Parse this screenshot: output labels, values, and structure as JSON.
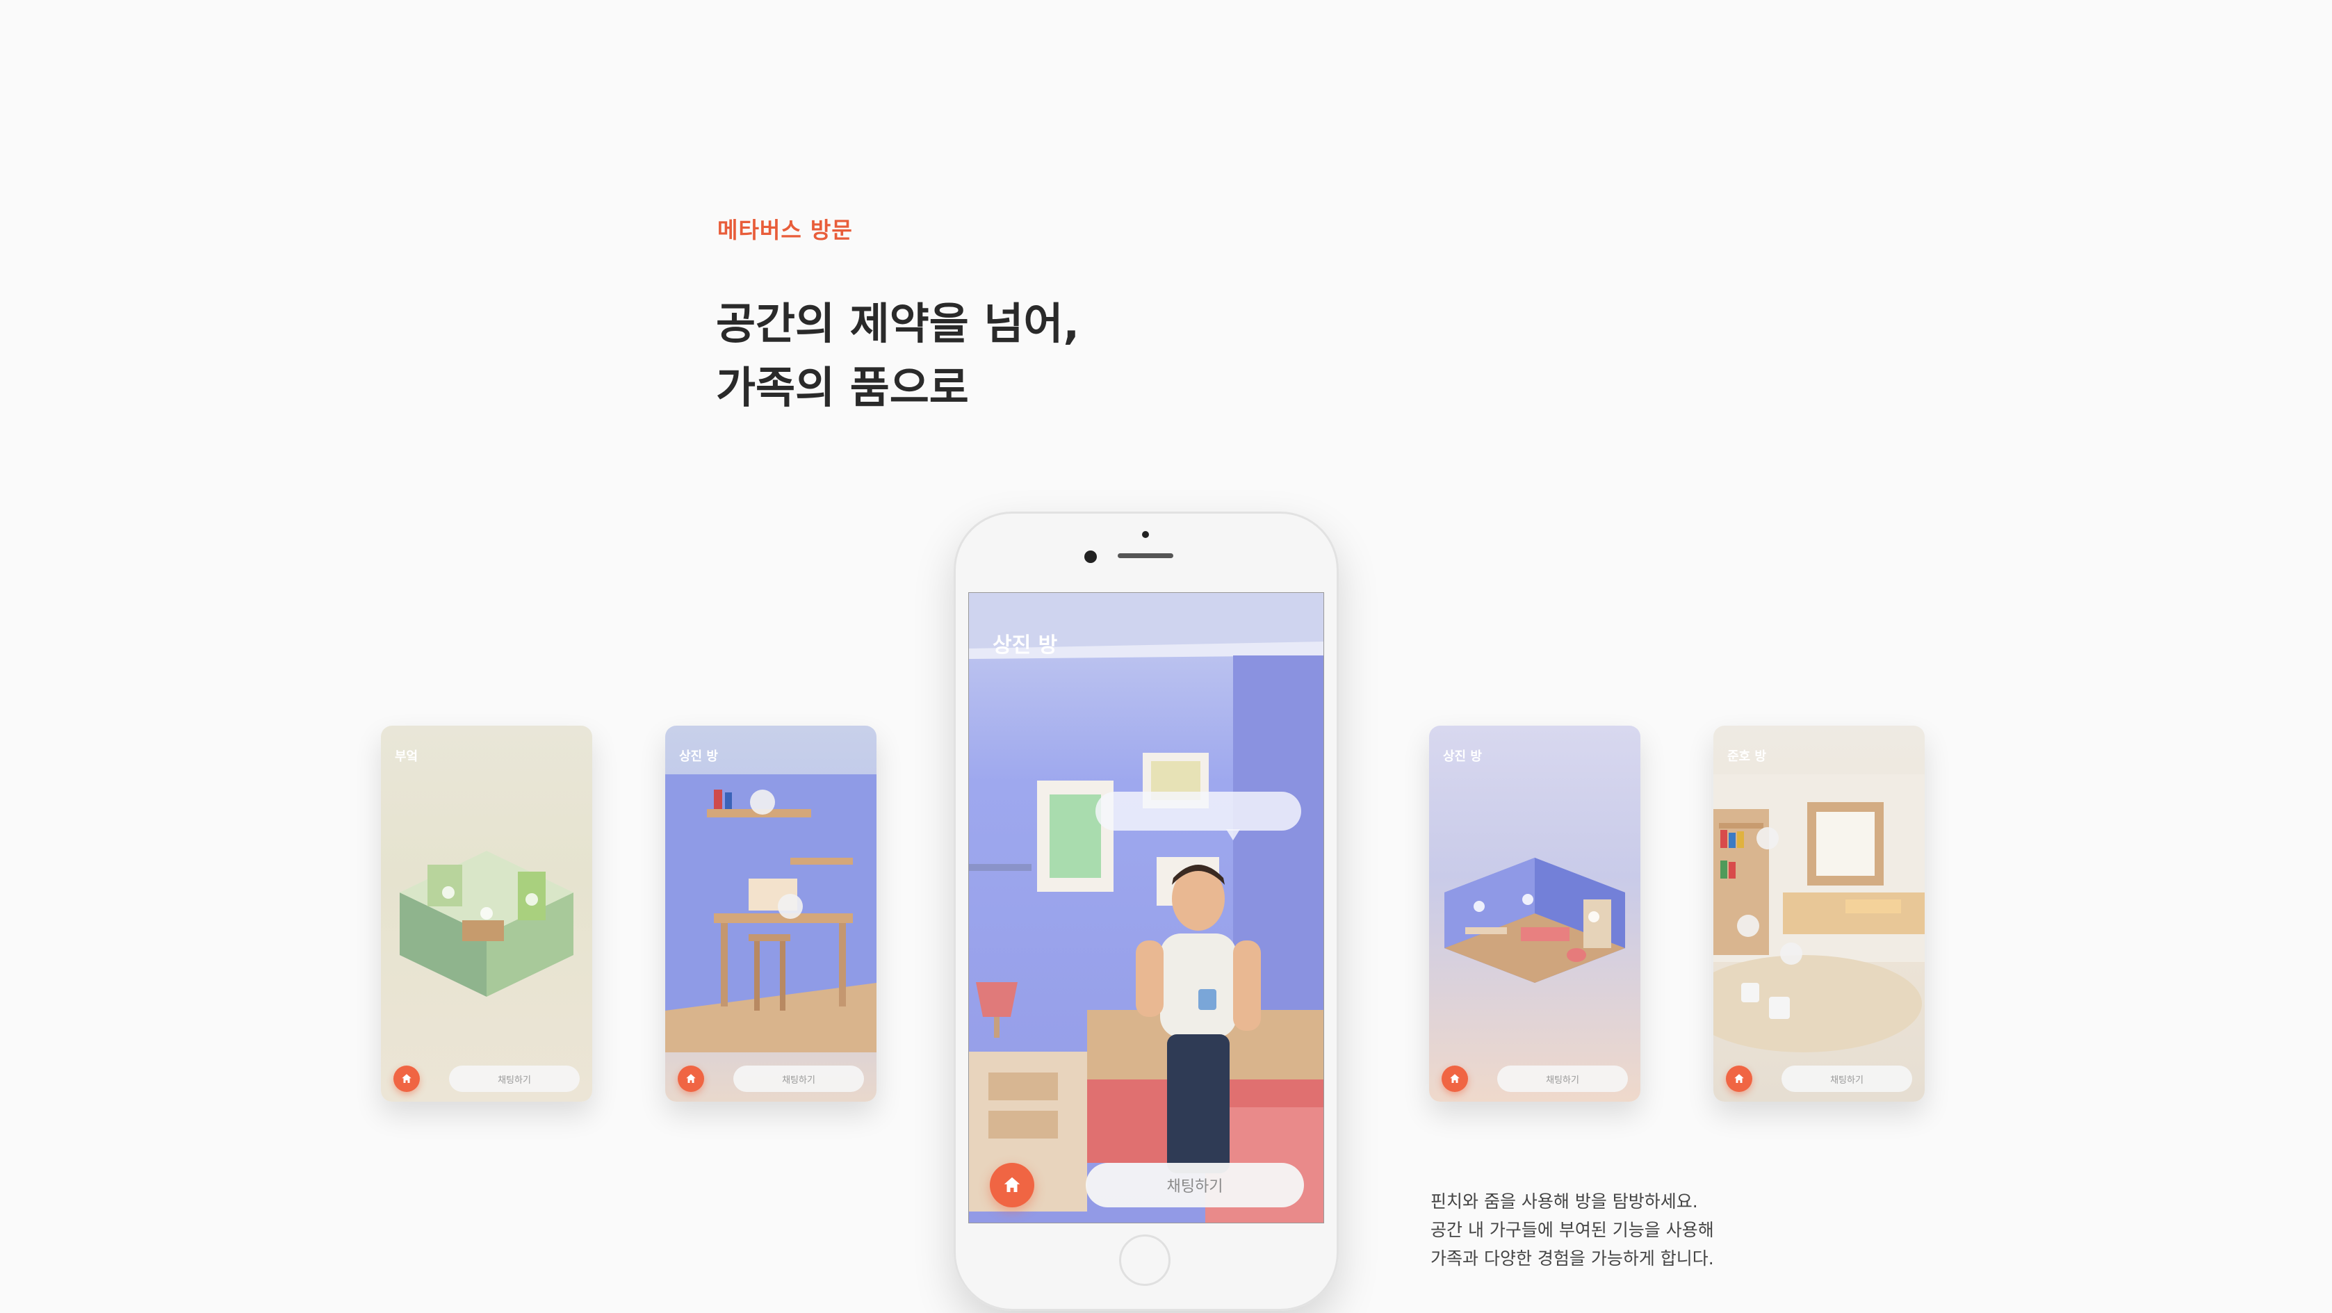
{
  "section": {
    "eyebrow": "메타버스 방문",
    "headline_line1": "공간의 제약을 넘어,",
    "headline_line2": "가족의 품으로"
  },
  "cards": [
    {
      "title": "부엌",
      "chat_label": "채팅하기"
    },
    {
      "title": "상진 방",
      "chat_label": "채팅하기"
    },
    {
      "title": "상진 방",
      "chat_label": "채팅하기"
    },
    {
      "title": "준호 방",
      "chat_label": "채팅하기"
    }
  ],
  "phone": {
    "title": "상진 방",
    "chat_label": "채팅하기"
  },
  "description": {
    "line1": "핀치와 줌을 사용해 방을 탐방하세요.",
    "line2": "공간 내 가구들에 부여된 기능을 사용해",
    "line3": "가족과 다양한 경험을 가능하게 합니다."
  },
  "colors": {
    "accent": "#e85d3a",
    "home_button": "#f06543",
    "background": "#fafafa"
  },
  "icons": [
    "home-icon",
    "book-icon",
    "play-icon",
    "photo-icon",
    "shirt-icon"
  ]
}
